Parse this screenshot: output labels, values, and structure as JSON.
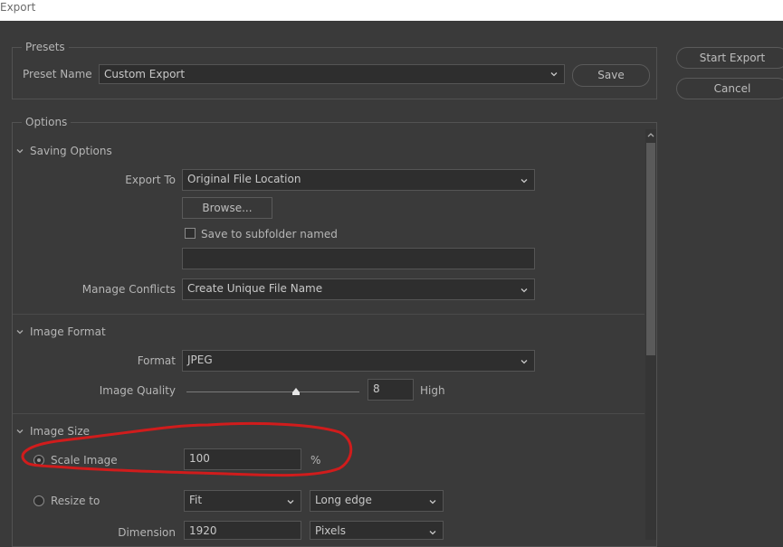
{
  "window": {
    "title": "Export"
  },
  "actions": {
    "start_export": "Start Export",
    "cancel": "Cancel"
  },
  "presets": {
    "legend": "Presets",
    "preset_name_label": "Preset Name",
    "preset_value": "Custom Export",
    "save_label": "Save"
  },
  "options": {
    "legend": "Options",
    "saving": {
      "title": "Saving Options",
      "export_to_label": "Export To",
      "export_to_value": "Original File Location",
      "browse_label": "Browse...",
      "subfolder_label": "Save to subfolder named",
      "subfolder_checked": false,
      "subfolder_value": "",
      "conflicts_label": "Manage Conflicts",
      "conflicts_value": "Create Unique File Name"
    },
    "format": {
      "title": "Image Format",
      "format_label": "Format",
      "format_value": "JPEG",
      "quality_label": "Image Quality",
      "quality_value": "8",
      "quality_fraction": 0.8,
      "quality_text": "High"
    },
    "size": {
      "title": "Image Size",
      "scale_label": "Scale Image",
      "scale_value": "100",
      "scale_unit": "%",
      "scale_selected": true,
      "resize_label": "Resize to",
      "resize_selected": false,
      "resize_mode": "Fit",
      "resize_edge": "Long edge",
      "dimension_label": "Dimension",
      "dimension_value": "1920",
      "dimension_unit": "Pixels"
    }
  },
  "annotation": {
    "color": "#d01c1c"
  },
  "icons": {
    "dropdown": "chevron-down-icon",
    "section": "chevron-down-icon",
    "scroll_up": "scroll-up-arrow-icon"
  }
}
